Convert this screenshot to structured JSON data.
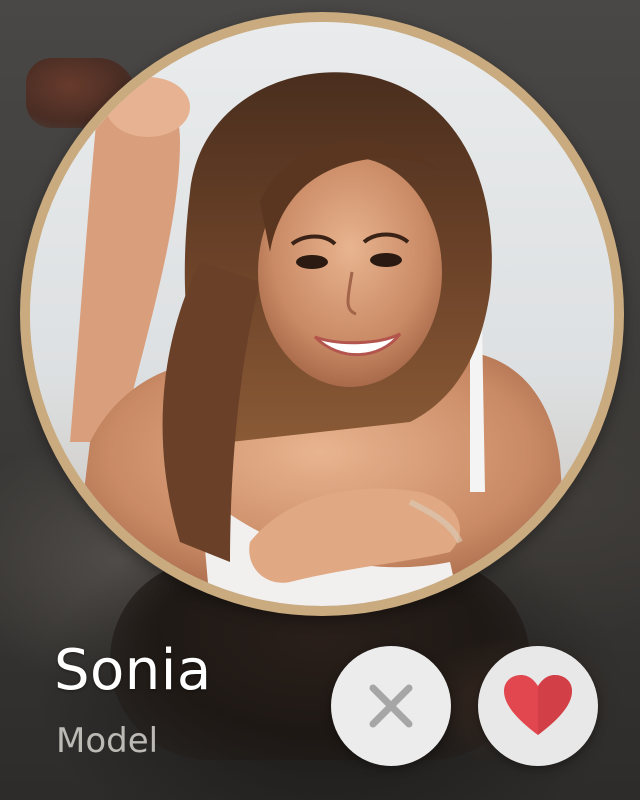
{
  "profile": {
    "name": "Sonia",
    "role": "Model",
    "ring_color": "#c9ab7f"
  },
  "actions": {
    "dislike_icon": "close-icon",
    "dislike_icon_color": "#a6a6a6",
    "like_icon": "heart-icon",
    "like_icon_color": "#e2474f"
  }
}
